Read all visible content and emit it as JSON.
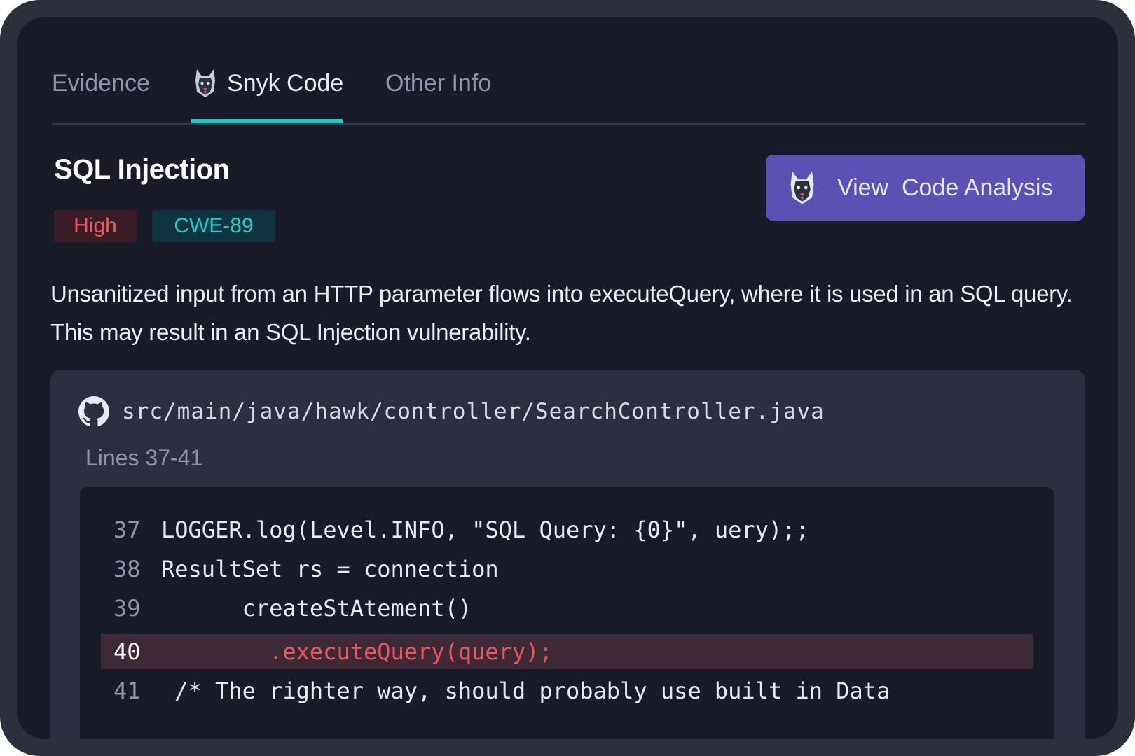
{
  "tabs": [
    {
      "label": "Evidence",
      "active": false
    },
    {
      "label": "Snyk Code",
      "active": true,
      "icon": "snyk-dog-icon"
    },
    {
      "label": "Other Info",
      "active": false
    }
  ],
  "issue": {
    "title": "SQL Injection",
    "severity": "High",
    "cwe": "CWE-89",
    "description": "Unsanitized input from an HTTP parameter flows into executeQuery, where it is used in an SQL query. This may result in an SQL Injection vulnerability."
  },
  "cta": {
    "label": "View  Code Analysis",
    "icon": "snyk-dog-icon"
  },
  "file": {
    "icon": "github-icon",
    "path": "src/main/java/hawk/controller/SearchController.java",
    "lines_label": "Lines 37-41"
  },
  "code": [
    {
      "number": "37",
      "text": "LOGGER.log(Level.INFO, \"SQL Query: {0}\", uery);;",
      "highlight": false
    },
    {
      "number": "38",
      "text": "ResultSet rs = connection",
      "highlight": false
    },
    {
      "number": "39",
      "text": "      createStAtement()",
      "highlight": false
    },
    {
      "number": "40",
      "text": "        .executeQuery(query);",
      "highlight": true
    },
    {
      "number": "41",
      "text": " /* The righter way, should probably use built in Data",
      "highlight": false
    }
  ],
  "colors": {
    "accent": "#1fc7c0",
    "button": "#5b50b4",
    "severity_high": "#f0575b",
    "cwe": "#1fd0c8"
  }
}
